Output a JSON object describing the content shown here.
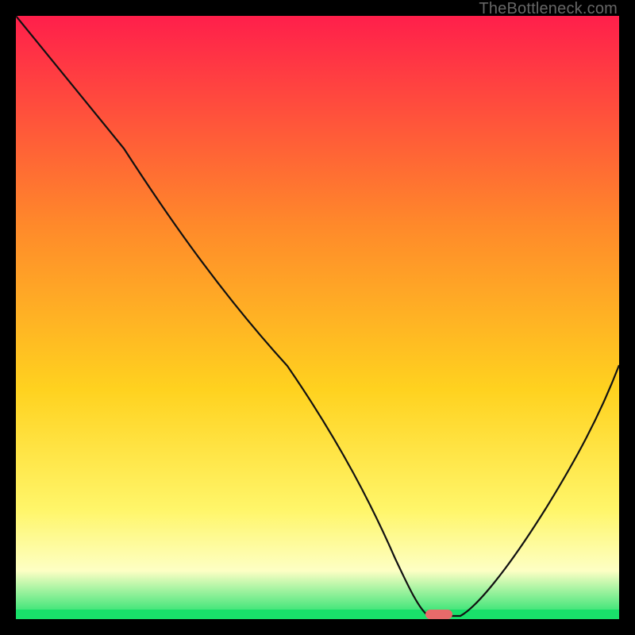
{
  "watermark": {
    "text": "TheBottleneck.com"
  },
  "colors": {
    "gradient_top": "#ff1f4b",
    "gradient_mid1": "#ff8a2a",
    "gradient_mid2": "#ffd21f",
    "gradient_mid3": "#fff66a",
    "gradient_band": "#fdffc4",
    "gradient_green": "#19e06a",
    "curve": "#111111",
    "marker": "#e86a6a",
    "frame": "#000000"
  },
  "chart_data": {
    "type": "line",
    "title": "",
    "xlabel": "",
    "ylabel": "",
    "xlim": [
      0,
      100
    ],
    "ylim": [
      0,
      100
    ],
    "series": [
      {
        "name": "bottleneck-curve",
        "x": [
          0,
          18,
          30,
          45,
          58,
          63,
          66,
          72,
          75,
          80,
          88,
          100
        ],
        "values": [
          100,
          78,
          62,
          42,
          22,
          10,
          3,
          0,
          0,
          5,
          18,
          42
        ]
      }
    ],
    "annotations": [
      {
        "name": "optimal-marker",
        "x": 70,
        "y": 0,
        "shape": "pill"
      }
    ],
    "background": {
      "type": "vertical-gradient",
      "stops": [
        {
          "pos": 0.0,
          "color": "#ff1f4b"
        },
        {
          "pos": 0.35,
          "color": "#ff8a2a"
        },
        {
          "pos": 0.62,
          "color": "#ffd21f"
        },
        {
          "pos": 0.82,
          "color": "#fff66a"
        },
        {
          "pos": 0.92,
          "color": "#fdffc4"
        },
        {
          "pos": 1.0,
          "color": "#19e06a"
        }
      ]
    }
  }
}
